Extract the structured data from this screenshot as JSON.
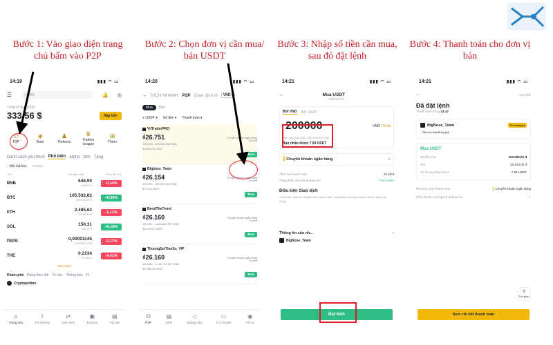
{
  "steps": [
    "Bước 1: Vào giao diện trang chủ bấm vào P2P",
    "Bước 2: Chọn đơn vị cần mua/ bán USDT",
    "Bước 3: Nhập số tiền cần mua, sau đó đặt lệnh",
    "Bước 4: Thanh toán cho đơn vị bán"
  ],
  "p1": {
    "time": "14:19",
    "search": "KAIA",
    "balance_label": "Tổng số dư (USD)",
    "balance": "333,56 $",
    "deposit": "Nạp tiền",
    "shortcuts": [
      "P2P",
      "Earn",
      "Referral",
      "Traders League",
      "Thêm"
    ],
    "tabs": [
      "Danh sách yêu thích",
      "Phổ biến",
      "Alpha",
      "Mới",
      "Tăng"
    ],
    "subtabs": [
      "Tiền mã hóa",
      "Futures"
    ],
    "col_h": [
      "Tên",
      "Giá gần nhất",
      "Thay đổi 24h"
    ],
    "markets": [
      {
        "n": "BNB",
        "p": "648,99",
        "s": "648,99 $",
        "c": "-0,14%",
        "up": false
      },
      {
        "n": "BTC",
        "p": "105.532,82",
        "s": "105.532,82 $",
        "c": "+0,06%",
        "up": true
      },
      {
        "n": "ETH",
        "p": "2.485,62",
        "s": "2.485,62 $",
        "c": "-1,13%",
        "up": false
      },
      {
        "n": "SOL",
        "p": "150,31",
        "s": "150,31 $",
        "c": "+0,18%",
        "up": true
      },
      {
        "n": "PEPE",
        "p": "0,00001145",
        "s": "0,00001145 $",
        "c": "-0,17%",
        "up": false
      },
      {
        "n": "THE",
        "p": "0,2234",
        "s": "0,2234 $",
        "c": "-4,41%",
        "up": false
      }
    ],
    "more": "Xem thêm",
    "bottom_tabs": [
      "Khám phá",
      "Đang theo dõi",
      "Tin tức",
      "Thông báo",
      "Pi"
    ],
    "news": "Cryptopolitan",
    "nav": [
      "Trang chủ",
      "Thị trường",
      "Giao dịch",
      "Futures",
      "Tài sản"
    ]
  },
  "p2": {
    "time": "14:20",
    "header": [
      "DỊCH NHANH",
      "P2P",
      "Giao dịch lô"
    ],
    "currency": "VND",
    "buy": "Mua",
    "sell": "Bán",
    "filters": [
      "USDT",
      "Số tiền",
      "Thanh toán"
    ],
    "offers": [
      {
        "name": "VilTraderPRO",
        "price": "26.751",
        "lim": "100.000 - 100.000.000 VND",
        "av": "40.640,00 USDT",
        "pay": "Chuyển khoản ngân hàng",
        "t": "15 phút"
      },
      {
        "name": "Bigboss_Team",
        "price": "26.154",
        "lim": "100.000 - 200.000.000 VND",
        "av": "974,44 USDT",
        "pay": "Chuyển khoản ngân hàng",
        "t": "15 phút"
      },
      {
        "name": "BendTheTrend",
        "price": "26.160",
        "lim": "100.000 - 1.021.611.901 VND",
        "av": "38.279,67 USDT",
        "pay": "Chuyển khoản ngân hàng",
        "t": "15 phút"
      },
      {
        "name": "ThuongSoiTienSo_VIP",
        "price": "26.160",
        "lim": "100.000 - 1.432.737.557 VND",
        "av": "54.585,69 USDT",
        "pay": "Chuyển khoản ngân hàng",
        "t": "15 phút"
      }
    ],
    "nav": [
      "P2P",
      "Lệnh",
      "Quảng cáo",
      "Trò chuyện",
      "Hồ sơ"
    ]
  },
  "p3": {
    "time": "14:21",
    "title": "Mua USDT",
    "subprice": "Giá 26.154",
    "tabs": [
      "Bởi VND",
      "Bởi USDT"
    ],
    "amount": "200000",
    "cur": "VND",
    "max": "Tối đa",
    "limit": "Hạn mức 100.000 - 200.000.000 VND",
    "receive": "Bạn nhận được 7,59 USDT",
    "method": "Chuyển khoản ngân hàng",
    "info": [
      [
        "Thời hạn thanh toán",
        "15 phút"
      ],
      [
        "Trạng thái của nhà quảng cáo",
        "Trực tuyến"
      ]
    ],
    "terms_title": "Điều kiện Giao dịch",
    "terms": "Chào bạn, cảm ơn đã giao dịch cùng Team. Quý khách vui lòng chuyển khoản đúng nội dung.",
    "adv_title": "Thông tin của nh...",
    "adv_name": "BigNose_Team",
    "order": "Đặt lệnh"
  },
  "p4": {
    "time": "14:21",
    "cancel": "Huỷ lệnh",
    "title": "Đã đặt lệnh",
    "timer_label": "Thanh toán trong",
    "timer": "14:47",
    "seller": "BigNose_Team",
    "seller_badge": "Trò chuyện",
    "verified": "Tiền mã hóa đã ký quỹ",
    "buy_label": "Mua USDT",
    "rows": [
      [
        "Số tiền Fiat",
        "200.000,00 đ"
      ],
      [
        "Giá",
        "26.154,00 đ"
      ],
      [
        "Số lượng nhận được",
        "7,59 USDT"
      ]
    ],
    "pay_method": [
      "Phương thức thanh toán",
      "Chuyển khoản ngân hàng"
    ],
    "terms": "Điều khoản của Người quảng cáo",
    "help": "Trợ giúp",
    "btn": "Xem chi tiết thanh toán"
  }
}
